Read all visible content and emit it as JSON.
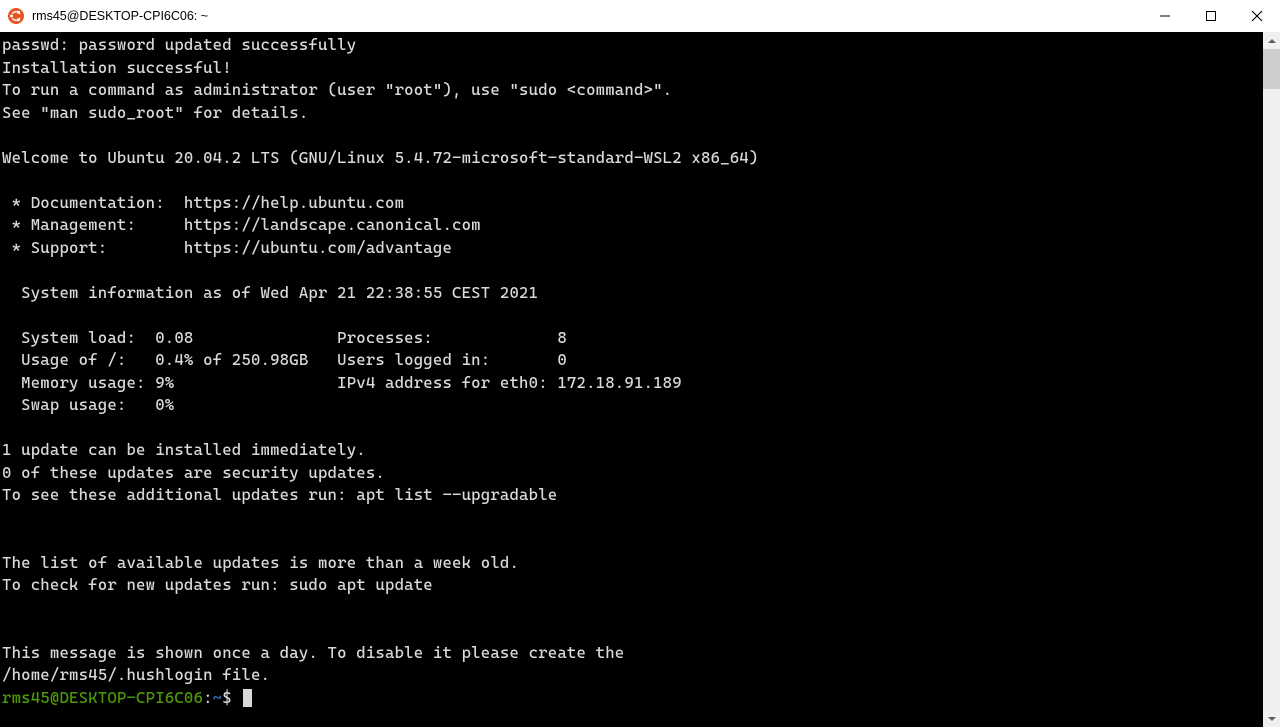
{
  "window": {
    "title": "rms45@DESKTOP-CPI6C06: ~"
  },
  "output": {
    "lines": [
      "passwd: password updated successfully",
      "Installation successful!",
      "To run a command as administrator (user \"root\"), use \"sudo <command>\".",
      "See \"man sudo_root\" for details.",
      "",
      "Welcome to Ubuntu 20.04.2 LTS (GNU/Linux 5.4.72-microsoft-standard-WSL2 x86_64)",
      "",
      " * Documentation:  https://help.ubuntu.com",
      " * Management:     https://landscape.canonical.com",
      " * Support:        https://ubuntu.com/advantage",
      "",
      "  System information as of Wed Apr 21 22:38:55 CEST 2021",
      "",
      "  System load:  0.08               Processes:             8",
      "  Usage of /:   0.4% of 250.98GB   Users logged in:       0",
      "  Memory usage: 9%                 IPv4 address for eth0: 172.18.91.189",
      "  Swap usage:   0%",
      "",
      "1 update can be installed immediately.",
      "0 of these updates are security updates.",
      "To see these additional updates run: apt list --upgradable",
      "",
      "",
      "The list of available updates is more than a week old.",
      "To check for new updates run: sudo apt update",
      "",
      "",
      "This message is shown once a day. To disable it please create the",
      "/home/rms45/.hushlogin file."
    ]
  },
  "prompt": {
    "user_host": "rms45@DESKTOP-CPI6C06",
    "colon": ":",
    "path": "~",
    "dollar": "$"
  }
}
